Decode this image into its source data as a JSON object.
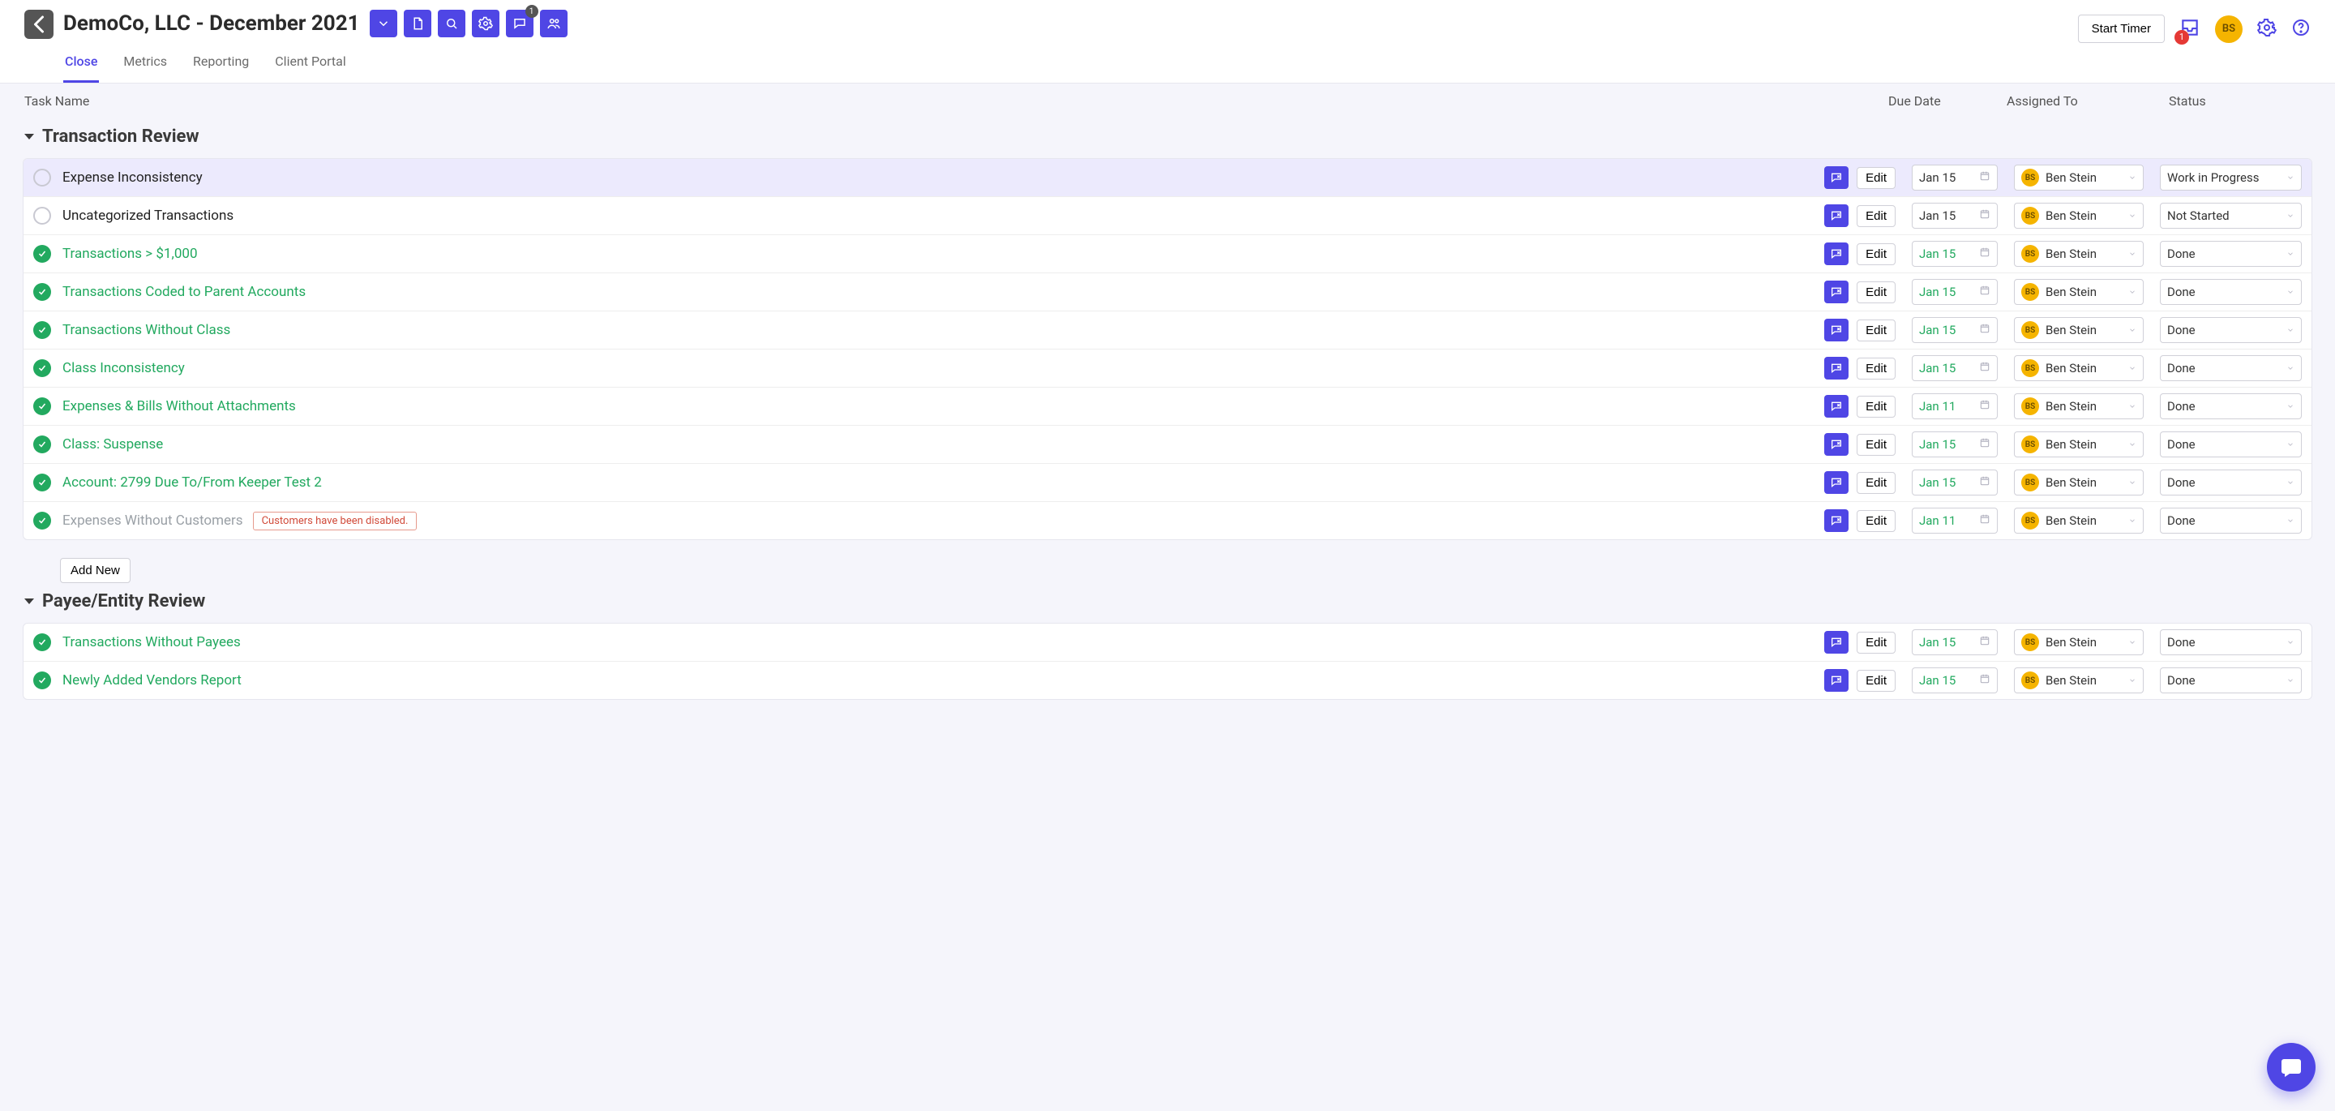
{
  "header": {
    "title": "DemoCo, LLC - December 2021",
    "toolbar_badge": "1",
    "tabs": [
      "Close",
      "Metrics",
      "Reporting",
      "Client Portal"
    ],
    "active_tab": 0,
    "start_timer": "Start Timer",
    "inbox_badge": "1",
    "avatar_initials": "BS"
  },
  "columns": {
    "task": "Task Name",
    "due": "Due Date",
    "assigned": "Assigned To",
    "status": "Status"
  },
  "assignee": {
    "initials": "BS",
    "name": "Ben Stein"
  },
  "statuses": {
    "wip": "Work in Progress",
    "ns": "Not Started",
    "done": "Done"
  },
  "add_new": "Add New",
  "edit_label": "Edit",
  "sections": [
    {
      "title": "Transaction Review",
      "rows": [
        {
          "name": "Expense Inconsistency",
          "done": false,
          "due": "Jan 15",
          "status_key": "wip",
          "selected": true
        },
        {
          "name": "Uncategorized Transactions",
          "done": false,
          "due": "Jan 15",
          "status_key": "ns"
        },
        {
          "name": "Transactions > $1,000",
          "done": true,
          "due": "Jan 15",
          "status_key": "done"
        },
        {
          "name": "Transactions Coded to Parent Accounts",
          "done": true,
          "due": "Jan 15",
          "status_key": "done"
        },
        {
          "name": "Transactions Without Class",
          "done": true,
          "due": "Jan 15",
          "status_key": "done"
        },
        {
          "name": "Class Inconsistency",
          "done": true,
          "due": "Jan 15",
          "status_key": "done"
        },
        {
          "name": "Expenses & Bills Without Attachments",
          "done": true,
          "due": "Jan 11",
          "status_key": "done"
        },
        {
          "name": "Class: Suspense",
          "done": true,
          "due": "Jan 15",
          "status_key": "done"
        },
        {
          "name": "Account: 2799 Due To/From Keeper Test 2",
          "done": true,
          "due": "Jan 15",
          "status_key": "done"
        },
        {
          "name": "Expenses Without Customers",
          "done": true,
          "due": "Jan 11",
          "status_key": "done",
          "muted": true,
          "tag": "Customers have been disabled."
        }
      ],
      "show_add": true
    },
    {
      "title": "Payee/Entity Review",
      "rows": [
        {
          "name": "Transactions Without Payees",
          "done": true,
          "due": "Jan 15",
          "status_key": "done"
        },
        {
          "name": "Newly Added Vendors Report",
          "done": true,
          "due": "Jan 15",
          "status_key": "done"
        }
      ],
      "show_add": false
    }
  ]
}
